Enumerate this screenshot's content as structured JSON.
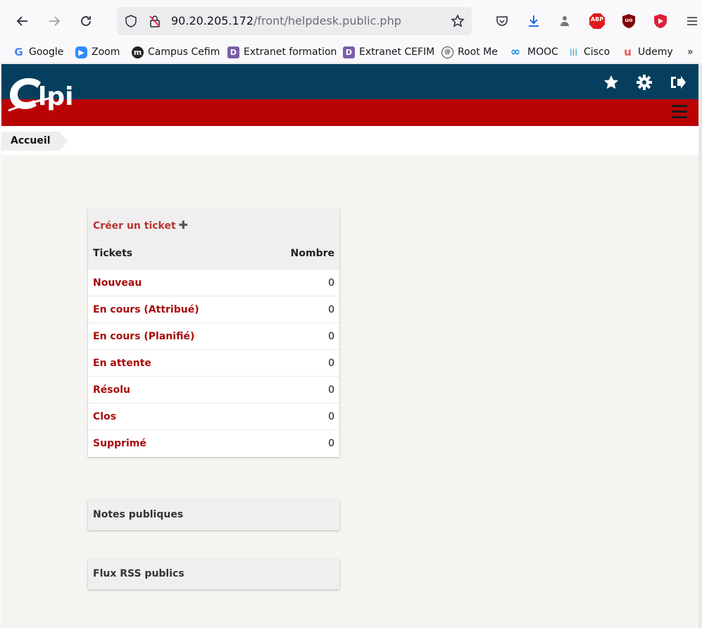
{
  "browser": {
    "url_host": "90.20.205.172",
    "url_path": "/front/helpdesk.public.php",
    "bookmarks": [
      "Google",
      "Zoom",
      "Campus Cefim",
      "Extranet formation",
      "Extranet CEFIM",
      "Root Me",
      "MOOC",
      "Cisco",
      "Udemy"
    ],
    "abp_label": "ABP",
    "ublock_label": "uo"
  },
  "app": {
    "logo_text": "Glpi",
    "breadcrumb": "Accueil"
  },
  "tickets_panel": {
    "create_label": "Créer un ticket",
    "col_tickets": "Tickets",
    "col_count": "Nombre",
    "rows": [
      {
        "label": "Nouveau",
        "value": "0"
      },
      {
        "label": "En cours (Attribué)",
        "value": "0"
      },
      {
        "label": "En cours (Planifié)",
        "value": "0"
      },
      {
        "label": "En attente",
        "value": "0"
      },
      {
        "label": "Résolu",
        "value": "0"
      },
      {
        "label": "Clos",
        "value": "0"
      },
      {
        "label": "Supprimé",
        "value": "0"
      }
    ]
  },
  "notes_panel": {
    "title": "Notes publiques"
  },
  "rss_panel": {
    "title": "Flux RSS publics"
  },
  "colors": {
    "header_blue": "#063f5e",
    "header_red": "#b90404",
    "link_red": "#a80b0b"
  }
}
